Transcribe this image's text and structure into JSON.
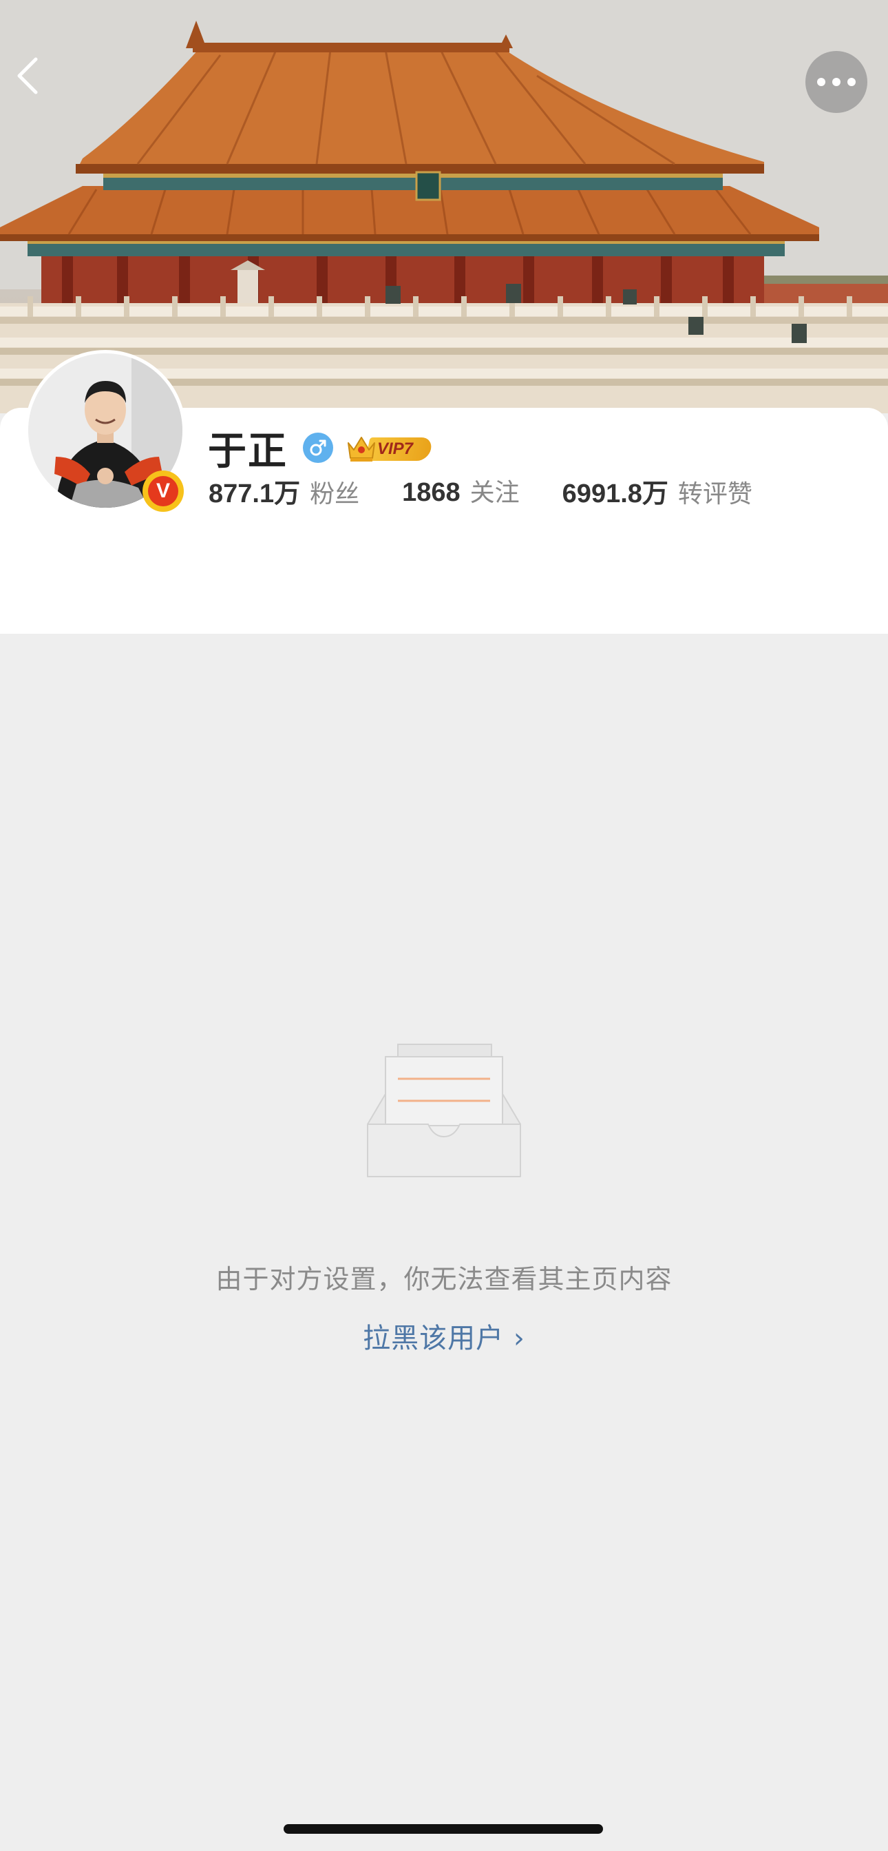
{
  "profile": {
    "name": "于正",
    "vip_label": "VIP7",
    "verified_mark": "V",
    "stats": [
      {
        "value": "877.1万",
        "label": "粉丝"
      },
      {
        "value": "1868",
        "label": "关注"
      },
      {
        "value": "6991.8万",
        "label": "转评赞"
      }
    ]
  },
  "empty_state": {
    "message": "由于对方设置，你无法查看其主页内容",
    "action_label": "拉黑该用户 ›"
  },
  "icons": {
    "back": "chevron-left-icon",
    "more": "ellipsis-icon",
    "gender": "male-icon",
    "vip": "crown-icon",
    "empty": "empty-inbox-icon"
  },
  "colors": {
    "link": "#4e77a6",
    "verified": "#e5391d",
    "vip_gold": "#f0b22a",
    "gender_blue": "#5fb1ee"
  }
}
